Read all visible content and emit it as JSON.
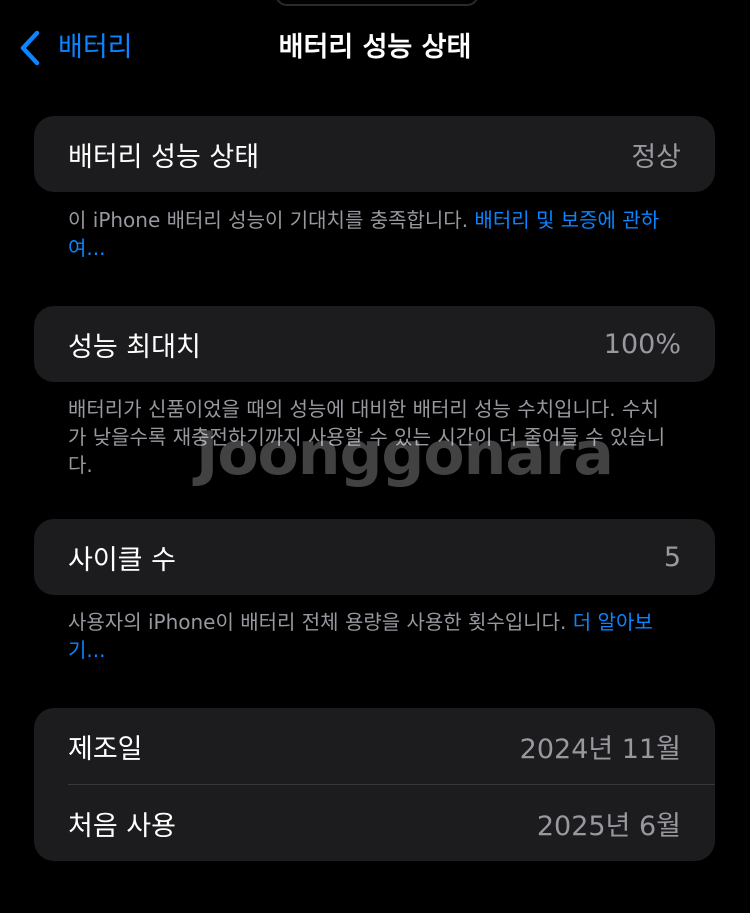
{
  "nav": {
    "back_label": "배터리",
    "title": "배터리 성능 상태"
  },
  "health": {
    "label": "배터리 성능 상태",
    "value": "정상",
    "footnote_text": "이 iPhone 배터리 성능이 기대치를 충족합니다. ",
    "footnote_link": "배터리 및 보증에 관하여..."
  },
  "max_capacity": {
    "label": "성능 최대치",
    "value": "100%",
    "footnote": "배터리가 신품이었을 때의 성능에 대비한 배터리 성능 수치입니다. 수치가 낮을수록 재충전하기까지 사용할 수 있는 시간이 더 줄어들 수 있습니다."
  },
  "cycle_count": {
    "label": "사이클 수",
    "value": "5",
    "footnote_text": "사용자의 iPhone이 배터리 전체 용량을 사용한 횟수입니다. ",
    "footnote_link": "더 알아보기..."
  },
  "dates": {
    "manufacture_label": "제조일",
    "manufacture_value": "2024년 11월",
    "first_use_label": "처음 사용",
    "first_use_value": "2025년 6월"
  },
  "watermark": "Joonggonara",
  "colors": {
    "accent": "#0a84ff",
    "background": "#000000",
    "group_background": "#1c1c1e",
    "secondary_text": "#98989f"
  }
}
